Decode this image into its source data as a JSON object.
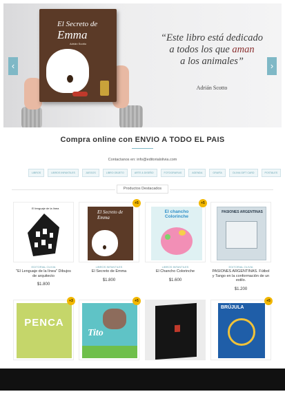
{
  "hero": {
    "book_title": "El Secreto de",
    "book_title_name": "Emma",
    "book_author": "Adrián Scotto",
    "quote_line1": "“Este libro está dedicado",
    "quote_line2a": "a todos los que ",
    "quote_highlight": "aman",
    "quote_line3": "a los animales”",
    "quote_author": "Adrián Scotto",
    "prev_label": "‹",
    "next_label": "›"
  },
  "heading": "Compra online con ENVIO A TODO EL PAIS",
  "contact": "Contactanos en: info@editorialolivia.com",
  "categories": [
    "LIBROS",
    "LIBROS INFANTILES",
    "JUEGOS",
    "LIBRO OBJETO",
    "ARTE & DISEÑO",
    "FOTOGRAFIAS",
    "AGENDA",
    "GRAFÍA",
    "OLIVIA GIFT CARD",
    "POSTALES"
  ],
  "featured_label": "Productos Destacados",
  "products": [
    {
      "category": "EDITORIAL OLIVIA",
      "name": "\"El Lenguaje de la línea\" Dibujos de arquitecto",
      "price": "$1.800",
      "badge": "",
      "cover_title": "El lenguaje de la línea"
    },
    {
      "category": "LIBROS INFANTILES",
      "name": "El Secreto de Emma",
      "price": "$1.800",
      "badge": "+5",
      "cover_title": "El Secreto de Emma"
    },
    {
      "category": "LIBROS INFANTILES",
      "name": "El Chancho Colorinche",
      "price": "$1.600",
      "badge": "+5",
      "cover_title": "El chancho Colorinche"
    },
    {
      "category": "EDITORIAL OLIVIA",
      "name": "PASIONES ARGENTINAS. Fútbol y Tango en la conformación de un estilo.",
      "price": "$1.200",
      "badge": "",
      "cover_title": "PASIONES ARGENTINAS"
    },
    {
      "category": "",
      "name": "",
      "price": "",
      "badge": "+3",
      "cover_title": "PENCA"
    },
    {
      "category": "",
      "name": "",
      "price": "",
      "badge": "+5",
      "cover_title": "Tito"
    },
    {
      "category": "",
      "name": "",
      "price": "",
      "badge": "",
      "cover_title": ""
    },
    {
      "category": "",
      "name": "",
      "price": "",
      "badge": "+5",
      "cover_title": "BRÚJULA"
    }
  ]
}
